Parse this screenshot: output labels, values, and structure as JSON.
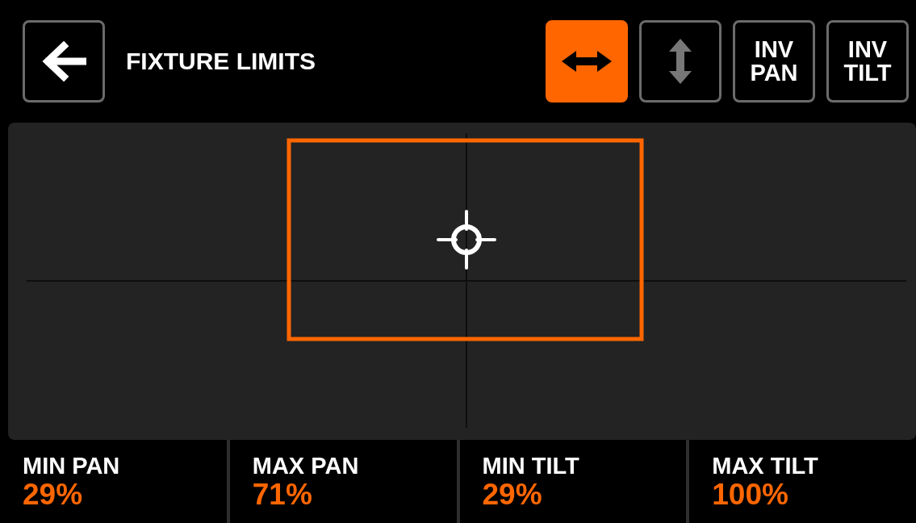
{
  "header": {
    "title": "FIXTURE LIMITS"
  },
  "axis_buttons": [
    {
      "kind": "pan",
      "selected": true
    },
    {
      "kind": "tilt",
      "selected": false
    }
  ],
  "invert_buttons": [
    {
      "label": "INV PAN"
    },
    {
      "label": "INV TILT"
    }
  ],
  "limits": [
    {
      "label": "MIN PAN",
      "value": "29%"
    },
    {
      "label": "MAX PAN",
      "value": "71%"
    },
    {
      "label": "MIN TILT",
      "value": "29%"
    },
    {
      "label": "MAX TILT",
      "value": "100%"
    }
  ]
}
